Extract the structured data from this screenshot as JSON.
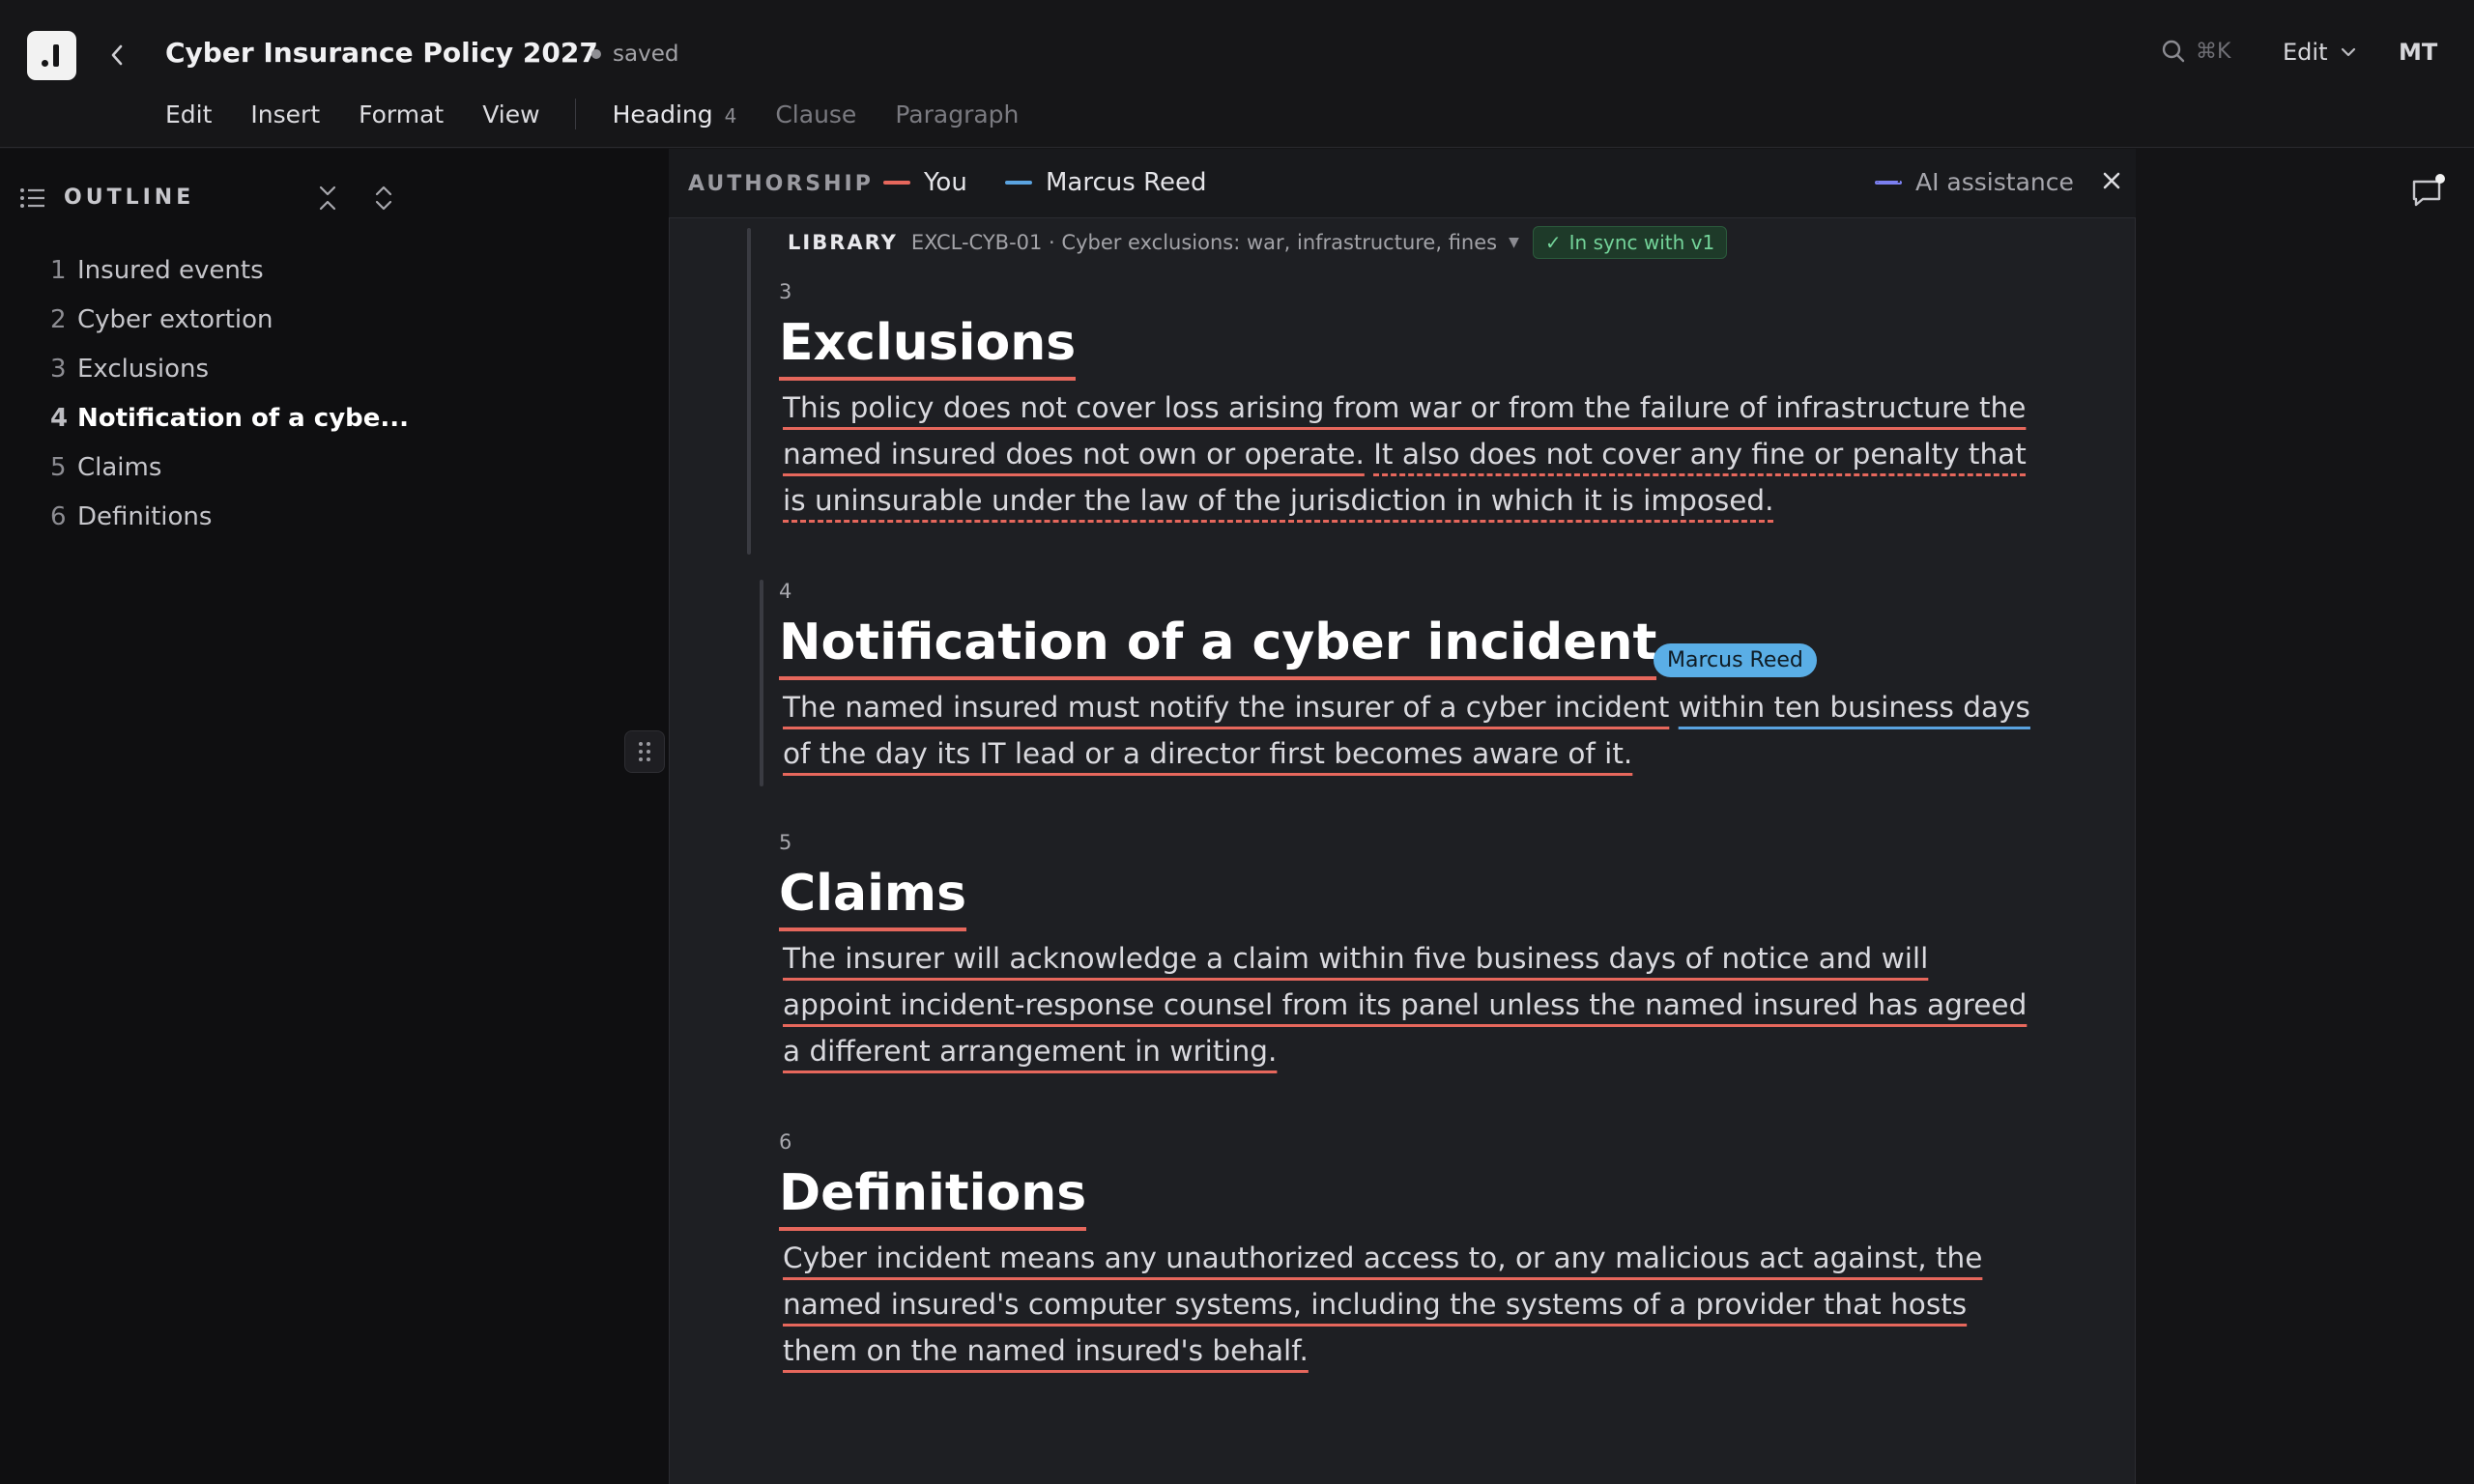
{
  "header": {
    "title": "Cyber Insurance Policy 2027",
    "save_status": "saved",
    "search_shortcut": "⌘K",
    "edit_menu_label": "Edit",
    "user_initials": "MT"
  },
  "menubar": {
    "items": [
      "Edit",
      "Insert",
      "Format",
      "View"
    ],
    "styles": [
      {
        "label": "Heading",
        "level": "4"
      },
      {
        "label": "Clause"
      },
      {
        "label": "Paragraph"
      }
    ]
  },
  "outline": {
    "label": "OUTLINE",
    "items": [
      {
        "num": "1",
        "label": "Insured events"
      },
      {
        "num": "2",
        "label": "Cyber extortion"
      },
      {
        "num": "3",
        "label": "Exclusions"
      },
      {
        "num": "4",
        "label": "Notification of a cybe..."
      },
      {
        "num": "5",
        "label": "Claims"
      },
      {
        "num": "6",
        "label": "Definitions"
      }
    ],
    "active_index": 3
  },
  "authorship": {
    "title": "AUTHORSHIP",
    "authors": [
      {
        "name": "You",
        "color": "#e6675c"
      },
      {
        "name": "Marcus Reed",
        "color": "#5aa3e0"
      }
    ],
    "ai_label": "AI assistance",
    "ai_color": "#7b7ff0"
  },
  "library": {
    "label": "LIBRARY",
    "reference": "EXCL-CYB-01 · Cyber exclusions: war, infrastructure, fines",
    "sync_status": "In sync with v1"
  },
  "sections": [
    {
      "num": "3",
      "title": "Exclusions",
      "body_you": "This policy does not cover loss arising from war or from the failure of infrastructure the named insured does not own or operate.",
      "body_ai": "It also does not cover any fine or penalty that is uninsurable under the law of the jurisdiction in which it is imposed."
    },
    {
      "num": "4",
      "title": "Notification of a cyber incident",
      "body_you_1": "The named insured must notify the insurer of a cyber incident",
      "body_marcus": "within ten business days",
      "body_you_2": "of the day its IT lead or a director first becomes aware of it.",
      "cursor_name": "Marcus Reed"
    },
    {
      "num": "5",
      "title": "Claims",
      "body": "The insurer will acknowledge a claim within five business days of notice and will appoint incident-response counsel from its panel unless the named insured has agreed a different arrangement in writing."
    },
    {
      "num": "6",
      "title": "Definitions",
      "body": "Cyber incident means any unauthorized access to, or any malicious act against, the named insured's computer systems, including the systems of a provider that hosts them on the named insured's behalf."
    }
  ]
}
